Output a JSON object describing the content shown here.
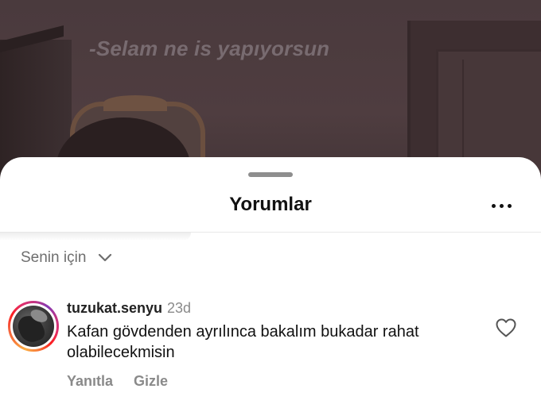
{
  "video": {
    "caption_overlay": "-Selam ne is yapıyorsun"
  },
  "sheet": {
    "title": "Yorumlar",
    "more_icon": "more-horizontal-icon",
    "filter": {
      "label": "Senin için",
      "icon": "chevron-down-icon"
    }
  },
  "comments": [
    {
      "username": "tuzukat.senyu",
      "time": "23d",
      "text": "Kafan gövdenden ayrılınca bakalım bukadar rahat olabilecekmisin",
      "actions": {
        "reply": "Yanıtla",
        "hide": "Gizle"
      },
      "like_icon": "heart-outline-icon",
      "avatar_has_story_ring": true
    }
  ],
  "colors": {
    "story_ring": [
      "#fcaf45",
      "#e1306c",
      "#833ab4"
    ],
    "secondary_text": "#8a8a8a"
  }
}
